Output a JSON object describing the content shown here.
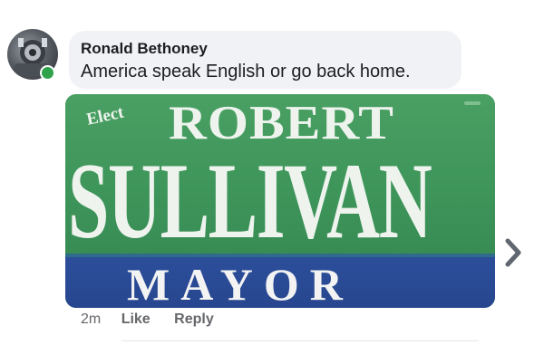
{
  "comment": {
    "author": "Ronald Bethoney",
    "text": "America speak English or go back home.",
    "online": true
  },
  "attachment": {
    "sign": {
      "elect": "Elect",
      "first_name": "ROBERT",
      "last_name": "SULLIVAN",
      "office": "MAYOR",
      "colors": {
        "green": "#3e955a",
        "blue": "#27468f",
        "text": "#eef3ee"
      }
    }
  },
  "meta": {
    "time": "2m",
    "like": "Like",
    "reply": "Reply"
  },
  "icons": {
    "avatar": "profile-photo",
    "online": "online-status-dot",
    "next": "chevron-right-icon"
  },
  "colors": {
    "bubble_bg": "#f0f2f5",
    "text_primary": "#1c1e21",
    "text_secondary": "#65676b",
    "online_green": "#31a24c"
  }
}
